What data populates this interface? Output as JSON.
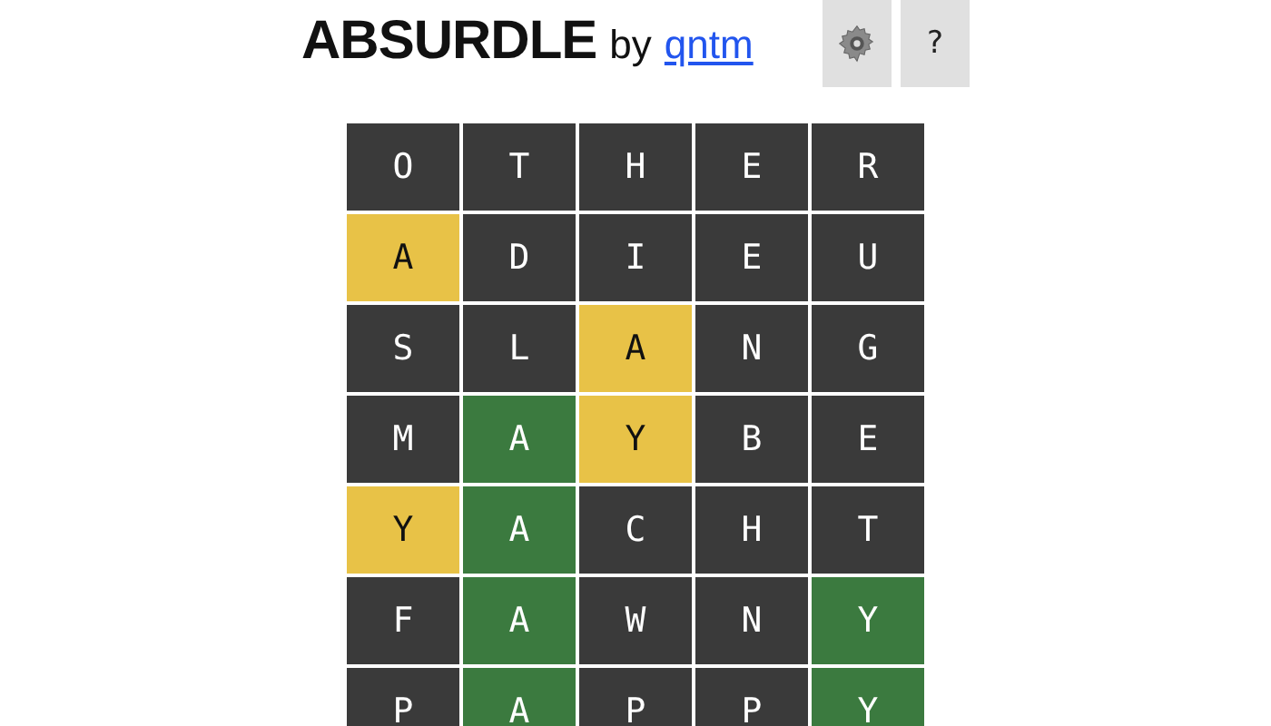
{
  "header": {
    "title": "ABSURDLE",
    "by": "by",
    "author_link": "qntm",
    "help_button": "?"
  },
  "grid": [
    [
      {
        "letter": "O",
        "color": "#3a3a3a"
      },
      {
        "letter": "T",
        "color": "#3a3a3a"
      },
      {
        "letter": "H",
        "color": "#3a3a3a"
      },
      {
        "letter": "E",
        "color": "#3a3a3a"
      },
      {
        "letter": "R",
        "color": "#3a3a3a"
      }
    ],
    [
      {
        "letter": "A",
        "color": "#e8c247"
      },
      {
        "letter": "D",
        "color": "#3a3a3a"
      },
      {
        "letter": "I",
        "color": "#3a3a3a"
      },
      {
        "letter": "E",
        "color": "#3a3a3a"
      },
      {
        "letter": "U",
        "color": "#3a3a3a"
      }
    ],
    [
      {
        "letter": "S",
        "color": "#3a3a3a"
      },
      {
        "letter": "L",
        "color": "#3a3a3a"
      },
      {
        "letter": "A",
        "color": "#e8c247"
      },
      {
        "letter": "N",
        "color": "#3a3a3a"
      },
      {
        "letter": "G",
        "color": "#3a3a3a"
      }
    ],
    [
      {
        "letter": "M",
        "color": "#3a3a3a"
      },
      {
        "letter": "A",
        "color": "#3b7a3f"
      },
      {
        "letter": "Y",
        "color": "#e8c247"
      },
      {
        "letter": "B",
        "color": "#3a3a3a"
      },
      {
        "letter": "E",
        "color": "#3a3a3a"
      }
    ],
    [
      {
        "letter": "Y",
        "color": "#e8c247"
      },
      {
        "letter": "A",
        "color": "#3b7a3f"
      },
      {
        "letter": "C",
        "color": "#3a3a3a"
      },
      {
        "letter": "H",
        "color": "#3a3a3a"
      },
      {
        "letter": "T",
        "color": "#3a3a3a"
      }
    ],
    [
      {
        "letter": "F",
        "color": "#3a3a3a"
      },
      {
        "letter": "A",
        "color": "#3b7a3f"
      },
      {
        "letter": "W",
        "color": "#3a3a3a"
      },
      {
        "letter": "N",
        "color": "#3a3a3a"
      },
      {
        "letter": "Y",
        "color": "#3b7a3f"
      }
    ],
    [
      {
        "letter": "P",
        "color": "#3a3a3a"
      },
      {
        "letter": "A",
        "color": "#3b7a3f"
      },
      {
        "letter": "P",
        "color": "#3a3a3a"
      },
      {
        "letter": "P",
        "color": "#3a3a3a"
      },
      {
        "letter": "Y",
        "color": "#3b7a3f"
      }
    ]
  ]
}
